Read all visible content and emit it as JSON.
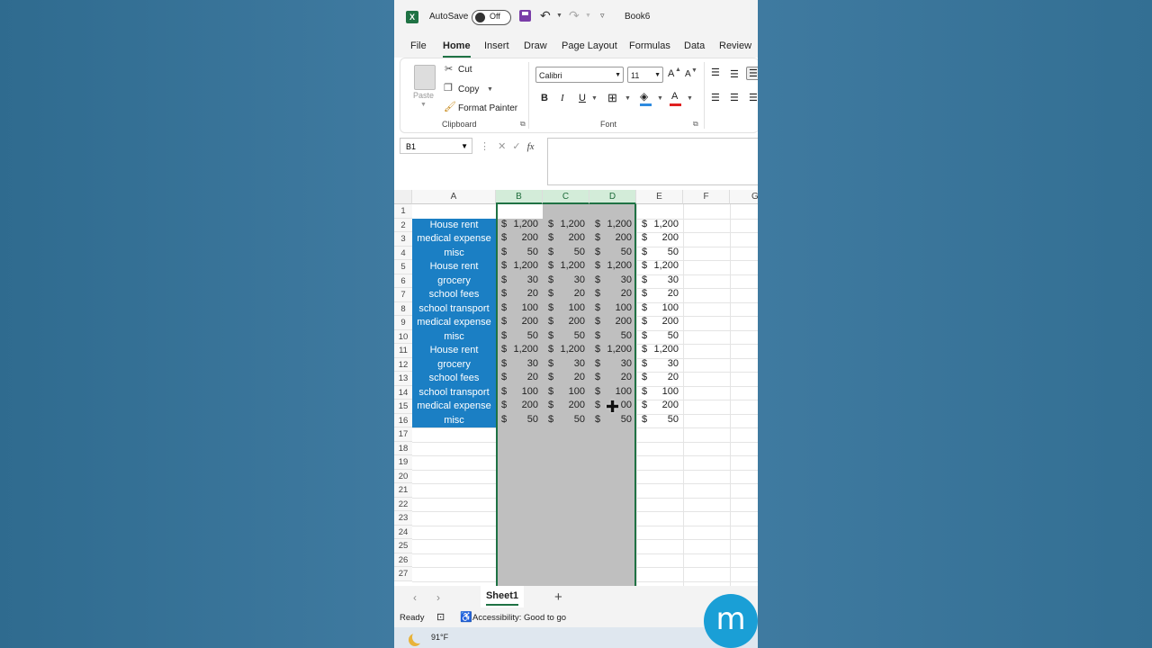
{
  "title_bar": {
    "autosave_label": "AutoSave",
    "autosave_state": "Off",
    "book_name": "Book6"
  },
  "menu": {
    "tabs": [
      "File",
      "Home",
      "Insert",
      "Draw",
      "Page Layout",
      "Formulas",
      "Data",
      "Review"
    ],
    "active_tab": "Home"
  },
  "ribbon": {
    "clipboard": {
      "paste": "Paste",
      "cut": "Cut",
      "copy": "Copy",
      "format_painter": "Format Painter",
      "group_label": "Clipboard"
    },
    "font": {
      "font_name": "Calibri",
      "font_size": "11",
      "grow": "A",
      "shrink": "A",
      "bold": "B",
      "italic": "I",
      "underline": "U",
      "font_color_letter": "A",
      "group_label": "Font"
    },
    "colors": {
      "fill": "#2e8be0",
      "font_color": "#e02020",
      "accent": "#1f7244"
    }
  },
  "formula_bar": {
    "name_box": "B1",
    "fx": "fx",
    "formula": ""
  },
  "sheet": {
    "columns": [
      "A",
      "B",
      "C",
      "D",
      "E",
      "F",
      "G"
    ],
    "selected_columns": [
      "B",
      "C",
      "D"
    ],
    "row_numbers": [
      "1",
      "2",
      "3",
      "4",
      "5",
      "6",
      "7",
      "8",
      "9",
      "10",
      "11",
      "12",
      "13",
      "14",
      "15",
      "16",
      "17",
      "18",
      "19",
      "20",
      "21",
      "22",
      "23",
      "24",
      "25",
      "26",
      "27"
    ],
    "rows": [
      {
        "label": "House rent",
        "b": "1,200",
        "c": "1,200",
        "d": "1,200",
        "e": "1,200"
      },
      {
        "label": "medical expense",
        "b": "200",
        "c": "200",
        "d": "200",
        "e": "200"
      },
      {
        "label": "misc",
        "b": "50",
        "c": "50",
        "d": "50",
        "e": "50"
      },
      {
        "label": "House rent",
        "b": "1,200",
        "c": "1,200",
        "d": "1,200",
        "e": "1,200"
      },
      {
        "label": "grocery",
        "b": "30",
        "c": "30",
        "d": "30",
        "e": "30"
      },
      {
        "label": "school fees",
        "b": "20",
        "c": "20",
        "d": "20",
        "e": "20"
      },
      {
        "label": "school transport",
        "b": "100",
        "c": "100",
        "d": "100",
        "e": "100"
      },
      {
        "label": "medical expense",
        "b": "200",
        "c": "200",
        "d": "200",
        "e": "200"
      },
      {
        "label": "misc",
        "b": "50",
        "c": "50",
        "d": "50",
        "e": "50"
      },
      {
        "label": "House rent",
        "b": "1,200",
        "c": "1,200",
        "d": "1,200",
        "e": "1,200"
      },
      {
        "label": "grocery",
        "b": "30",
        "c": "30",
        "d": "30",
        "e": "30"
      },
      {
        "label": "school fees",
        "b": "20",
        "c": "20",
        "d": "20",
        "e": "20"
      },
      {
        "label": "school transport",
        "b": "100",
        "c": "100",
        "d": "100",
        "e": "100"
      },
      {
        "label": "medical expense",
        "b": "200",
        "c": "200",
        "d": "00",
        "e": "200"
      },
      {
        "label": "misc",
        "b": "50",
        "c": "50",
        "d": "50",
        "e": "50"
      }
    ],
    "currency_symbol": "$",
    "label_fill": "#1b7fc4",
    "selection_fill": "#bfbfbf"
  },
  "sheet_tabs": {
    "active": "Sheet1",
    "add": "+"
  },
  "status": {
    "ready": "Ready",
    "accessibility": "Accessibility: Good to go"
  },
  "taskbar": {
    "temperature": "91°F"
  },
  "watermark": {
    "letter": "m"
  }
}
